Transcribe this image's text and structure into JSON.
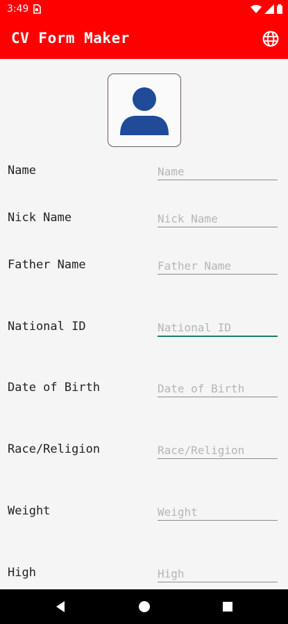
{
  "status": {
    "time": "3:49"
  },
  "app": {
    "title": "CV Form Maker",
    "accent": "#ff0000"
  },
  "icons": {
    "language": "globe-icon",
    "photo": "person-icon",
    "status": [
      "sim-icon",
      "wifi-icon",
      "signal-icon",
      "battery-icon"
    ],
    "nav": [
      "back-icon",
      "home-icon",
      "recents-icon"
    ]
  },
  "form": {
    "fields": [
      {
        "label": "Name",
        "placeholder": "Name"
      },
      {
        "label": "Nick Name",
        "placeholder": "Nick Name"
      },
      {
        "label": "Father Name",
        "placeholder": "Father Name"
      },
      {
        "label": "National ID",
        "placeholder": "National ID"
      },
      {
        "label": "Date of Birth",
        "placeholder": "Date of Birth"
      },
      {
        "label": "Race/Religion",
        "placeholder": "Race/Religion"
      },
      {
        "label": "Weight",
        "placeholder": "Weight"
      },
      {
        "label": "High",
        "placeholder": "High"
      }
    ]
  }
}
